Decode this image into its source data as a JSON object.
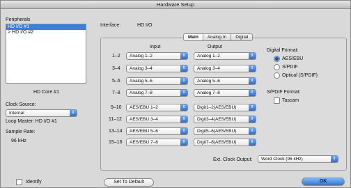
{
  "window": {
    "title": "Hardware Setup"
  },
  "sidebar": {
    "peripherals_label": "Peripherals",
    "items": [
      {
        "label": "HD I/O #1",
        "selected": true
      },
      {
        "label": "> HD I/O #2",
        "selected": false
      }
    ],
    "device_name": "HD Core #1",
    "clock_source_label": "Clock Source:",
    "clock_source_value": "Internal",
    "loop_master": "Loop Master: HD I/O #1",
    "sample_rate_label": "Sample Rate:",
    "sample_rate_value": "96 kHz"
  },
  "interface": {
    "label": "Interface:",
    "value": "HD I/O"
  },
  "tabs": [
    {
      "label": "Main",
      "active": true
    },
    {
      "label": "Analog In",
      "active": false
    },
    {
      "label": "Digital",
      "active": false
    }
  ],
  "io": {
    "input_header": "Input",
    "output_header": "Output",
    "rows": [
      {
        "channel": "1–2",
        "input": "Analog 1–2",
        "output": "Analog 1–2"
      },
      {
        "channel": "3–4",
        "input": "Analog 3–4",
        "output": "Analog 3–4"
      },
      {
        "channel": "5–6",
        "input": "Analog 5–6",
        "output": "Analog 5–6"
      },
      {
        "channel": "7–8",
        "input": "Analog 7–8",
        "output": "Analog 7–8"
      },
      {
        "channel": "9–10",
        "input": "AES/EBU 1–2",
        "output": "Digit1–2(AES/EBU)"
      },
      {
        "channel": "11–12",
        "input": "AES/EBU 3–4",
        "output": "Digit3–4(AES/EBU)"
      },
      {
        "channel": "13–14",
        "input": "AES/EBU 5–6",
        "output": "Digit5–6(AES/EBU)"
      },
      {
        "channel": "15–16",
        "input": "AES/EBU 7–8",
        "output": "Digit7–8(AES/EBU)"
      }
    ]
  },
  "digital_format": {
    "label": "Digital Format:",
    "options": [
      {
        "label": "AES/EBU",
        "selected": true
      },
      {
        "label": "S/PDIF",
        "selected": false
      },
      {
        "label": "Optical (S/PDIF)",
        "selected": false
      }
    ]
  },
  "spdif_format": {
    "label": "S/PDIF Format:",
    "tascam_label": "Tascam",
    "tascam_checked": false
  },
  "ext_clock": {
    "label": "Ext. Clock Output:",
    "value": "Word Clock (96 kHz)"
  },
  "footer": {
    "identify_label": "Identify",
    "set_default_label": "Set To Default",
    "ok_label": "OK"
  }
}
